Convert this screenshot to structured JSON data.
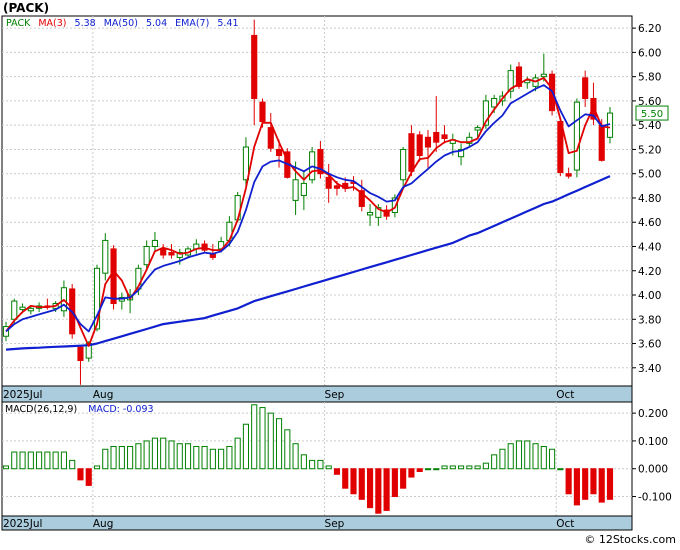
{
  "title": "(PACK)",
  "footer": "© 12Stocks.com",
  "legend": {
    "ticker": "PACK",
    "ma3": "MA(3)",
    "ma3_value": "5.38",
    "ma50": "MA(50)",
    "ma50_value": "5.04",
    "ema7": "EMA(7)",
    "ema7_value": "5.41",
    "macd_params": "MACD(26,12,9)",
    "macd_label": "MACD:",
    "macd_value": "-0.093"
  },
  "last_price": "5.50",
  "colors": {
    "up": "#008000",
    "down": "#e00000",
    "ma_fast": "#e00000",
    "ma_slow": "#1020d0",
    "axis_band": "#aaccdd",
    "grid": "#cccccc"
  },
  "chart_data": [
    {
      "type": "candlestick",
      "y_ticks": [
        "6.20",
        "6.00",
        "5.80",
        "5.60",
        "5.40",
        "5.20",
        "5.00",
        "4.80",
        "4.60",
        "4.40",
        "4.20",
        "4.00",
        "3.80",
        "3.60",
        "3.40"
      ],
      "x_ticks": [
        "2025Jul",
        "Aug",
        "Sep",
        "Oct"
      ],
      "ylim": [
        3.25,
        6.3
      ],
      "series": [
        {
          "name": "PACK",
          "ohlc": [
            [
              3.66,
              3.78,
              3.62,
              3.74
            ],
            [
              3.8,
              3.97,
              3.76,
              3.95
            ],
            [
              3.88,
              3.93,
              3.85,
              3.9
            ],
            [
              3.87,
              3.91,
              3.84,
              3.89
            ],
            [
              3.89,
              3.94,
              3.86,
              3.91
            ],
            [
              3.91,
              3.97,
              3.88,
              3.9
            ],
            [
              3.89,
              3.95,
              3.86,
              3.93
            ],
            [
              3.87,
              4.12,
              3.82,
              4.06
            ],
            [
              4.05,
              4.09,
              3.64,
              3.68
            ],
            [
              3.57,
              3.58,
              3.26,
              3.46
            ],
            [
              3.48,
              3.62,
              3.45,
              3.6
            ],
            [
              3.72,
              4.25,
              3.7,
              4.22
            ],
            [
              4.18,
              4.51,
              4.12,
              4.45
            ],
            [
              4.38,
              4.41,
              3.88,
              3.93
            ],
            [
              3.95,
              4.02,
              3.88,
              3.98
            ],
            [
              3.96,
              4.05,
              3.85,
              4.0
            ],
            [
              4.05,
              4.25,
              4.0,
              4.22
            ],
            [
              4.25,
              4.45,
              4.22,
              4.4
            ],
            [
              4.4,
              4.52,
              4.36,
              4.45
            ],
            [
              4.38,
              4.42,
              4.3,
              4.33
            ],
            [
              4.35,
              4.42,
              4.3,
              4.33
            ],
            [
              4.31,
              4.38,
              4.25,
              4.35
            ],
            [
              4.33,
              4.4,
              4.3,
              4.38
            ],
            [
              4.38,
              4.46,
              4.34,
              4.42
            ],
            [
              4.42,
              4.45,
              4.35,
              4.37
            ],
            [
              4.34,
              4.42,
              4.29,
              4.31
            ],
            [
              4.38,
              4.48,
              4.35,
              4.44
            ],
            [
              4.45,
              4.65,
              4.4,
              4.6
            ],
            [
              4.62,
              4.85,
              4.6,
              4.82
            ],
            [
              4.95,
              5.3,
              4.9,
              5.22
            ],
            [
              6.14,
              6.27,
              5.4,
              5.62
            ],
            [
              5.59,
              5.62,
              5.38,
              5.43
            ],
            [
              5.38,
              5.5,
              5.18,
              5.21
            ],
            [
              5.2,
              5.28,
              5.05,
              5.15
            ],
            [
              5.18,
              5.21,
              4.96,
              4.97
            ],
            [
              4.78,
              5.1,
              4.66,
              4.95
            ],
            [
              4.82,
              5.02,
              4.7,
              4.92
            ],
            [
              4.95,
              5.22,
              4.92,
              5.18
            ],
            [
              5.2,
              5.27,
              4.96,
              5.0
            ],
            [
              4.97,
              5.08,
              4.76,
              4.88
            ],
            [
              4.9,
              4.94,
              4.82,
              4.88
            ],
            [
              4.92,
              4.97,
              4.85,
              4.88
            ],
            [
              4.93,
              4.98,
              4.86,
              4.92
            ],
            [
              4.86,
              4.95,
              4.69,
              4.73
            ],
            [
              4.66,
              4.75,
              4.57,
              4.68
            ],
            [
              4.64,
              4.75,
              4.57,
              4.72
            ],
            [
              4.7,
              4.74,
              4.62,
              4.65
            ],
            [
              4.68,
              4.83,
              4.64,
              4.8
            ],
            [
              4.95,
              5.22,
              4.9,
              5.2
            ],
            [
              5.33,
              5.4,
              4.98,
              5.02
            ],
            [
              5.32,
              5.35,
              5.1,
              5.15
            ],
            [
              5.3,
              5.36,
              5.05,
              5.22
            ],
            [
              5.34,
              5.64,
              5.18,
              5.26
            ],
            [
              5.32,
              5.4,
              5.25,
              5.29
            ],
            [
              5.25,
              5.33,
              5.15,
              5.28
            ],
            [
              5.14,
              5.25,
              5.07,
              5.2
            ],
            [
              5.25,
              5.34,
              5.22,
              5.3
            ],
            [
              5.36,
              5.4,
              5.3,
              5.38
            ],
            [
              5.4,
              5.65,
              5.37,
              5.6
            ],
            [
              5.55,
              5.65,
              5.5,
              5.62
            ],
            [
              5.6,
              5.68,
              5.56,
              5.64
            ],
            [
              5.68,
              5.9,
              5.62,
              5.85
            ],
            [
              5.88,
              5.92,
              5.7,
              5.72
            ],
            [
              5.75,
              5.8,
              5.7,
              5.77
            ],
            [
              5.72,
              5.82,
              5.68,
              5.79
            ],
            [
              5.8,
              5.99,
              5.76,
              5.82
            ],
            [
              5.82,
              5.85,
              5.48,
              5.52
            ],
            [
              5.43,
              5.45,
              4.98,
              5.01
            ],
            [
              5.0,
              5.05,
              4.96,
              4.98
            ],
            [
              5.03,
              5.62,
              4.97,
              5.59
            ],
            [
              5.79,
              5.85,
              5.55,
              5.62
            ],
            [
              5.62,
              5.75,
              5.4,
              5.45
            ],
            [
              5.4,
              5.45,
              5.1,
              5.11
            ],
            [
              5.3,
              5.55,
              5.25,
              5.5
            ]
          ]
        },
        {
          "name": "EMA(7)",
          "values": [
            3.7,
            3.76,
            3.8,
            3.82,
            3.84,
            3.86,
            3.88,
            3.92,
            3.86,
            3.76,
            3.7,
            3.83,
            3.98,
            3.97,
            3.97,
            3.98,
            4.04,
            4.13,
            4.21,
            4.24,
            4.26,
            4.28,
            4.31,
            4.33,
            4.35,
            4.34,
            4.36,
            4.42,
            4.52,
            4.7,
            4.93,
            5.06,
            5.1,
            5.11,
            5.08,
            5.05,
            5.02,
            5.06,
            5.04,
            5.0,
            4.97,
            4.95,
            4.94,
            4.89,
            4.84,
            4.81,
            4.77,
            4.78,
            4.89,
            4.92,
            4.98,
            5.04,
            5.1,
            5.15,
            5.18,
            5.19,
            5.22,
            5.26,
            5.35,
            5.42,
            5.48,
            5.58,
            5.62,
            5.66,
            5.7,
            5.73,
            5.68,
            5.52,
            5.39,
            5.44,
            5.49,
            5.48,
            5.39,
            5.41
          ]
        },
        {
          "name": "MA(3)",
          "values": [
            3.7,
            3.79,
            3.86,
            3.91,
            3.9,
            3.9,
            3.91,
            3.96,
            3.89,
            3.73,
            3.58,
            3.76,
            4.09,
            4.2,
            4.12,
            3.97,
            4.07,
            4.21,
            4.36,
            4.39,
            4.37,
            4.34,
            4.35,
            4.38,
            4.39,
            4.37,
            4.37,
            4.45,
            4.62,
            4.88,
            5.22,
            5.42,
            5.42,
            5.26,
            5.11,
            5.02,
            4.95,
            5.02,
            5.03,
            4.99,
            4.92,
            4.88,
            4.89,
            4.84,
            4.78,
            4.71,
            4.68,
            4.72,
            4.88,
            5.01,
            5.12,
            5.13,
            5.21,
            5.26,
            5.28,
            5.26,
            5.26,
            5.29,
            5.43,
            5.53,
            5.62,
            5.7,
            5.74,
            5.78,
            5.76,
            5.79,
            5.7,
            5.45,
            5.17,
            5.19,
            5.4,
            5.55,
            5.39,
            5.38
          ]
        },
        {
          "name": "MA(50)",
          "values": [
            3.55,
            3.555,
            3.56,
            3.563,
            3.566,
            3.57,
            3.573,
            3.576,
            3.579,
            3.582,
            3.586,
            3.6,
            3.62,
            3.64,
            3.66,
            3.68,
            3.7,
            3.72,
            3.74,
            3.76,
            3.77,
            3.78,
            3.79,
            3.8,
            3.81,
            3.83,
            3.85,
            3.87,
            3.89,
            3.92,
            3.95,
            3.97,
            3.99,
            4.01,
            4.03,
            4.05,
            4.07,
            4.09,
            4.11,
            4.13,
            4.15,
            4.17,
            4.19,
            4.21,
            4.23,
            4.25,
            4.27,
            4.29,
            4.31,
            4.33,
            4.35,
            4.37,
            4.39,
            4.41,
            4.43,
            4.46,
            4.49,
            4.51,
            4.54,
            4.57,
            4.6,
            4.63,
            4.66,
            4.69,
            4.72,
            4.75,
            4.77,
            4.8,
            4.83,
            4.86,
            4.89,
            4.92,
            4.95,
            4.98
          ]
        }
      ]
    },
    {
      "type": "bar",
      "title": "MACD(26,12,9)",
      "y_ticks": [
        "0.200",
        "0.100",
        "0.000",
        "-0.100"
      ],
      "ylim": [
        -0.17,
        0.24
      ],
      "series": [
        {
          "name": "MACD(26,12,9)",
          "values": [
            0.01,
            0.06,
            0.06,
            0.06,
            0.06,
            0.06,
            0.06,
            0.06,
            0.03,
            -0.04,
            -0.06,
            0.01,
            0.07,
            0.08,
            0.08,
            0.08,
            0.09,
            0.1,
            0.11,
            0.11,
            0.1,
            0.09,
            0.09,
            0.08,
            0.08,
            0.07,
            0.07,
            0.08,
            0.11,
            0.16,
            0.23,
            0.22,
            0.2,
            0.18,
            0.14,
            0.09,
            0.05,
            0.03,
            0.03,
            0.01,
            -0.02,
            -0.07,
            -0.09,
            -0.11,
            -0.14,
            -0.16,
            -0.15,
            -0.1,
            -0.07,
            -0.03,
            -0.01,
            0.0,
            0.0,
            0.01,
            0.01,
            0.01,
            0.01,
            0.01,
            0.02,
            0.05,
            0.07,
            0.09,
            0.1,
            0.1,
            0.09,
            0.08,
            0.07,
            0.0,
            -0.09,
            -0.13,
            -0.11,
            -0.09,
            -0.12,
            -0.11
          ]
        }
      ]
    }
  ]
}
